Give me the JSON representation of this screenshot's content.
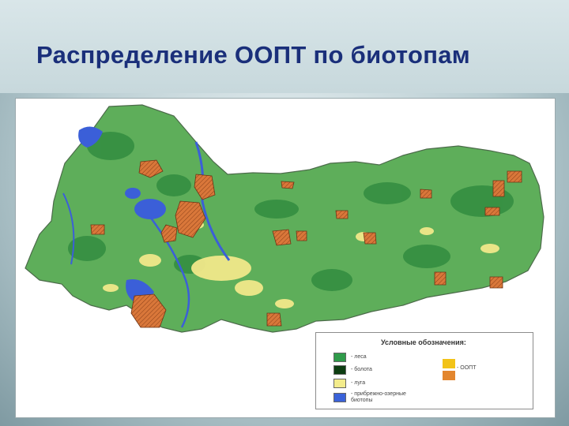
{
  "title": "Распределение ООПТ по биотопам",
  "legend": {
    "title": "Условные обозначения:",
    "items": [
      {
        "label": "- леса",
        "color": "#2f9b4a"
      },
      {
        "label": "- болота",
        "color": "#0d3d12"
      },
      {
        "label": "- луга",
        "color": "#f3ec8c"
      },
      {
        "label": "- прибрежно-озерные",
        "label2": "биотопы",
        "color": "#3a62d9"
      }
    ],
    "oopt_label": "- ООПТ",
    "oopt_colors": [
      "#f2c318",
      "#e3862e"
    ]
  },
  "colors": {
    "forest": "#5eae5a",
    "forest_dark": "#2f8a3e",
    "water": "#3b5fd8",
    "meadow": "#f1e88a",
    "oopt": "#d9773a"
  }
}
